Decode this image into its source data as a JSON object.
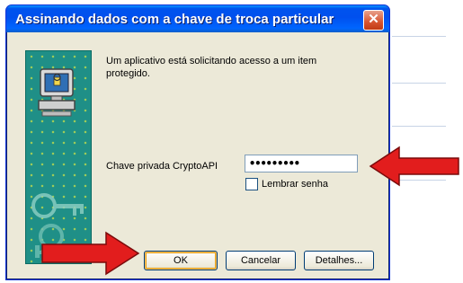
{
  "window": {
    "title": "Assinando dados com a chave de troca particular",
    "close_glyph": "✕"
  },
  "dialog": {
    "message": "Um aplicativo está solicitando acesso a um item protegido.",
    "password_label": "Chave privada CryptoAPI",
    "password_value": "•••••••••",
    "remember_label": "Lembrar senha",
    "remember_checked": false
  },
  "buttons": {
    "ok": "OK",
    "cancel": "Cancelar",
    "details": "Detalhes..."
  },
  "colors": {
    "titlebar": "#0053ee",
    "panel": "#1f8f87",
    "annotation": "#e21d1d"
  },
  "icons": {
    "panel_icon": "computer-icon",
    "annotation_arrow": "red-arrow-icon"
  }
}
